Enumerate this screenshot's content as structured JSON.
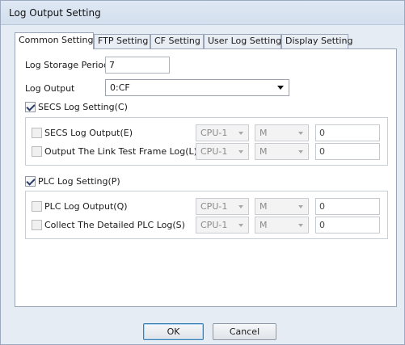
{
  "window": {
    "title": "Log Output Setting"
  },
  "tabs": [
    {
      "label": "Common Setting",
      "active": true
    },
    {
      "label": "FTP Setting"
    },
    {
      "label": "CF Setting"
    },
    {
      "label": "User Log Setting"
    },
    {
      "label": "Display Setting"
    }
  ],
  "common": {
    "log_storage_period_label": "Log Storage Period",
    "log_storage_period_value": "7",
    "log_output_label": "Log Output",
    "log_output_value": "0:CF"
  },
  "secs": {
    "section_label": "SECS Log Setting(C)",
    "section_checked": true,
    "rows": [
      {
        "label": "SECS Log Output(E)",
        "checked": false,
        "cpu": "CPU-1",
        "device": "M",
        "value": "0"
      },
      {
        "label": "Output The Link Test Frame Log(L)",
        "checked": false,
        "cpu": "CPU-1",
        "device": "M",
        "value": "0"
      }
    ]
  },
  "plc": {
    "section_label": "PLC Log Setting(P)",
    "section_checked": true,
    "rows": [
      {
        "label": "PLC Log Output(Q)",
        "checked": false,
        "cpu": "CPU-1",
        "device": "M",
        "value": "0"
      },
      {
        "label": "Collect The Detailed PLC Log(S)",
        "checked": false,
        "cpu": "CPU-1",
        "device": "M",
        "value": "0"
      }
    ]
  },
  "buttons": {
    "ok": "OK",
    "cancel": "Cancel"
  }
}
